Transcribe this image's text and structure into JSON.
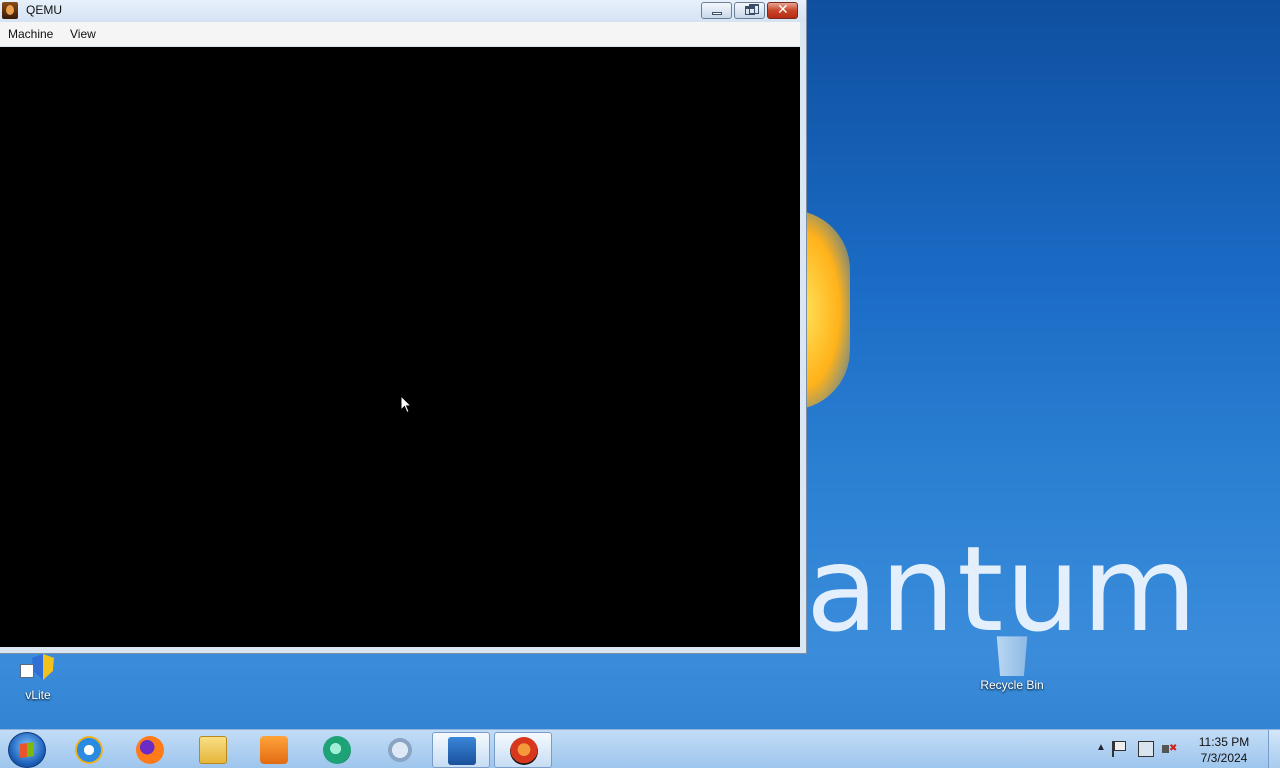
{
  "window": {
    "title": "QEMU",
    "menu": [
      {
        "label": "Machine"
      },
      {
        "label": "View"
      }
    ],
    "screen_color": "#000000"
  },
  "wallpaper": {
    "brand_text": "antum"
  },
  "desktop_icons": [
    {
      "label": "vLite",
      "icon": "vlite-shortcut-icon"
    },
    {
      "label": "Recycle Bin",
      "icon": "recycle-bin-icon"
    }
  ],
  "taskbar": {
    "pinned": [
      {
        "name": "internet-explorer",
        "icon": "ie-icon"
      },
      {
        "name": "firefox",
        "icon": "firefox-icon"
      },
      {
        "name": "windows-explorer",
        "icon": "folder-icon"
      },
      {
        "name": "media-player",
        "icon": "media-player-icon"
      },
      {
        "name": "network-app",
        "icon": "network-icon"
      },
      {
        "name": "tools",
        "icon": "tools-icon"
      },
      {
        "name": "powershell",
        "icon": "powershell-icon"
      },
      {
        "name": "qemu",
        "icon": "qemu-icon",
        "active": true
      }
    ],
    "clock": {
      "time": "11:35 PM",
      "date": "7/3/2024"
    }
  },
  "colors": {
    "desktop": "#1a6ac4",
    "close_button": "#c9452a"
  }
}
